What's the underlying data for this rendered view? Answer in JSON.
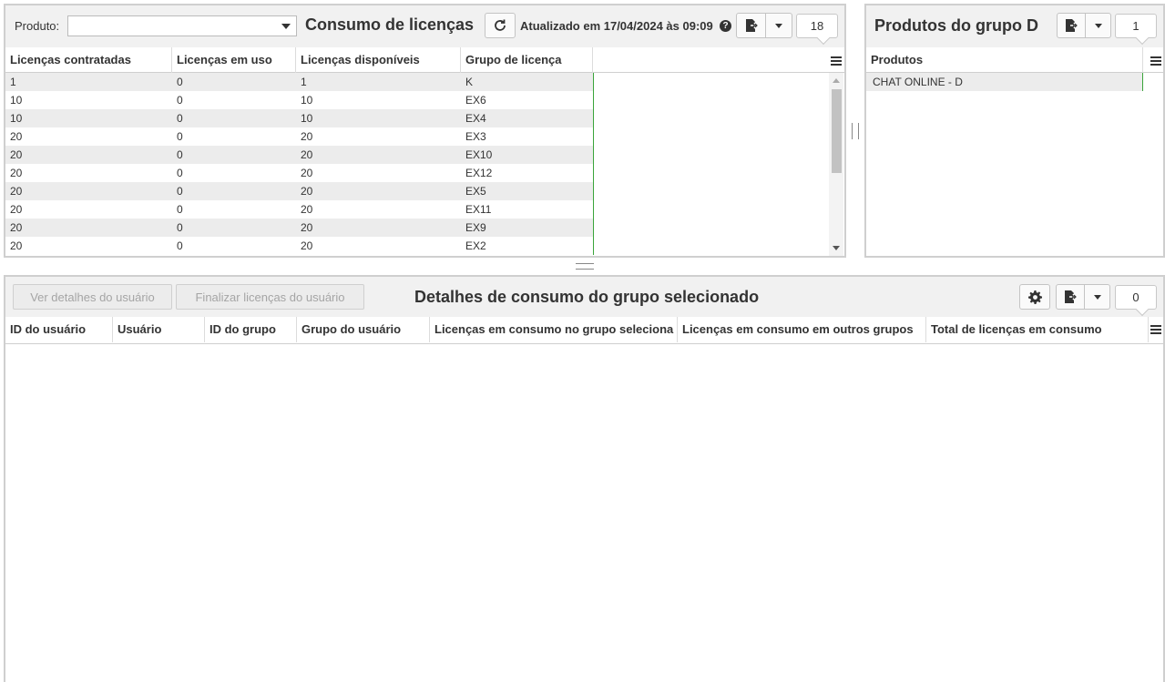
{
  "licenses": {
    "product_label": "Produto:",
    "product_value": "",
    "title": "Consumo de licenças",
    "updated": "Atualizado em 17/04/2024 às 09:09",
    "help": "?",
    "count": "18",
    "columns": [
      "Licenças contratadas",
      "Licenças em uso",
      "Licenças disponíveis",
      "Grupo de licença"
    ],
    "rows": [
      [
        "1",
        "0",
        "1",
        "K"
      ],
      [
        "10",
        "0",
        "10",
        "EX6"
      ],
      [
        "10",
        "0",
        "10",
        "EX4"
      ],
      [
        "20",
        "0",
        "20",
        "EX3"
      ],
      [
        "20",
        "0",
        "20",
        "EX10"
      ],
      [
        "20",
        "0",
        "20",
        "EX12"
      ],
      [
        "20",
        "0",
        "20",
        "EX5"
      ],
      [
        "20",
        "0",
        "20",
        "EX11"
      ],
      [
        "20",
        "0",
        "20",
        "EX9"
      ],
      [
        "20",
        "0",
        "20",
        "EX2"
      ]
    ]
  },
  "products": {
    "title": "Produtos do grupo D",
    "count": "1",
    "columns": [
      "Produtos"
    ],
    "rows": [
      [
        "CHAT ONLINE - D"
      ]
    ]
  },
  "details": {
    "view_user_button": "Ver detalhes do usuário",
    "finalize_button": "Finalizar licenças do usuário",
    "title": "Detalhes de consumo do grupo selecionado",
    "count": "0",
    "columns": [
      "ID do usuário",
      "Usuário",
      "ID do grupo",
      "Grupo do usuário",
      "Licenças em consumo no grupo seleciona",
      "Licenças em consumo em outros grupos",
      "Total de licenças em consumo"
    ],
    "rows": []
  },
  "icons": {
    "refresh": "refresh-icon",
    "export": "export-file-icon",
    "settings": "gear-icon",
    "columns_menu": "hamburger-menu-icon"
  },
  "colors": {
    "selected_marker": "#3aa43a",
    "alt_row": "#ececec",
    "toolbar": "#f1f1f1"
  }
}
